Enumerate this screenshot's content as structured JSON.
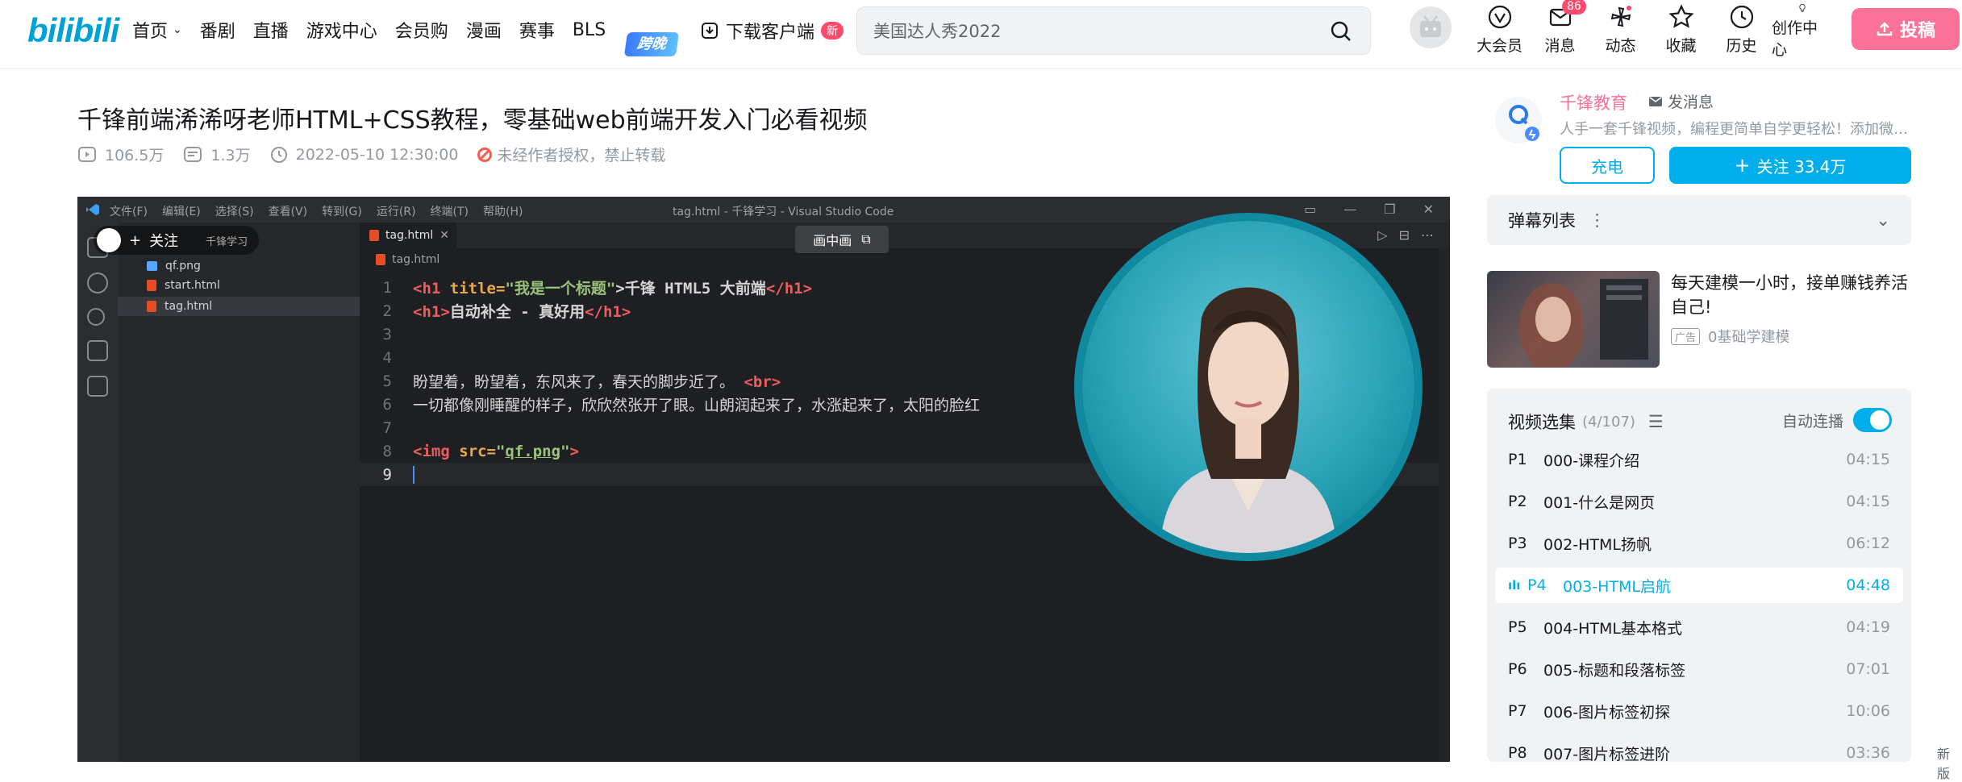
{
  "header": {
    "logo": "bilibili",
    "nav": [
      "首页",
      "番剧",
      "直播",
      "游戏中心",
      "会员购",
      "漫画",
      "赛事",
      "BLS"
    ],
    "bls_badge": "跨晚",
    "download": "下载客户端",
    "download_badge": "新",
    "search_value": "美国达人秀2022",
    "entries": [
      "大会员",
      "消息",
      "动态",
      "收藏",
      "历史",
      "创作中心"
    ],
    "message_count": "86",
    "upload": "投稿"
  },
  "video": {
    "title": "千锋前端浠浠呀老师HTML+CSS教程，零基础web前端开发入门必看视频",
    "views": "106.5万",
    "danmaku": "1.3万",
    "date": "2022-05-10 12:30:00",
    "notice": "未经作者授权，禁止转载"
  },
  "player": {
    "vs_menu": [
      "文件(F)",
      "编辑(E)",
      "选择(S)",
      "查看(V)",
      "转到(G)",
      "运行(R)",
      "终端(T)",
      "帮助(H)"
    ],
    "vs_title": "tag.html - 千锋学习 - Visual Studio Code",
    "follow_chip": "关注",
    "explorer_ghost": "千锋学习",
    "files": [
      "qf.png",
      "start.html",
      "tag.html"
    ],
    "tab": "tag.html",
    "breadcrumb": "tag.html",
    "pip_chip": "画中画",
    "lines": [
      "1",
      "2",
      "3",
      "4",
      "5",
      "6",
      "7",
      "8",
      "9"
    ],
    "code": {
      "l1_a": "<h1 ",
      "l1_attr": "title=",
      "l1_str": "\"我是一个标题\"",
      "l1_b": ">千锋 HTML5 大前端",
      "l1_c": "</h1>",
      "l2_a": "<h1>",
      "l2_b": "自动补全 - 真好用",
      "l2_c": "</h1>",
      "l5": "盼望着，盼望着，东风来了，春天的脚步近了。 ",
      "l5_br": "<br>",
      "l6": "一切都像刚睡醒的样子，欣欣然张开了眼。山朗润起来了，水涨起来了，太阳的脸红",
      "l8_a": "<img ",
      "l8_attr": "src=",
      "l8_q1": "\"",
      "l8_val": "qf.png",
      "l8_q2": "\"",
      "l8_b": ">"
    }
  },
  "uploader": {
    "name": "千锋教育",
    "message": "发消息",
    "desc": "人手一套千锋视频，编程更简单自学更轻松！添加微信：qianfengjiaoyu",
    "charge": "充电",
    "follow": "关注 33.4万"
  },
  "danmaku_list": "弹幕列表",
  "ad": {
    "title": "每天建模一小时，接单赚钱养活自己!",
    "tag": "广告",
    "source": "0基础学建模"
  },
  "playlist": {
    "title": "视频选集",
    "count": "(4/107)",
    "autoplay": "自动连播",
    "items": [
      {
        "num": "P1",
        "title": "000-课程介绍",
        "dur": "04:15"
      },
      {
        "num": "P2",
        "title": "001-什么是网页",
        "dur": "04:15"
      },
      {
        "num": "P3",
        "title": "002-HTML扬帆",
        "dur": "06:12"
      },
      {
        "num": "P4",
        "title": "003-HTML启航",
        "dur": "04:48"
      },
      {
        "num": "P5",
        "title": "004-HTML基本格式",
        "dur": "04:19"
      },
      {
        "num": "P6",
        "title": "005-标题和段落标签",
        "dur": "07:01"
      },
      {
        "num": "P7",
        "title": "006-图片标签初探",
        "dur": "10:06"
      },
      {
        "num": "P8",
        "title": "007-图片标签进阶",
        "dur": "03:36"
      }
    ]
  },
  "side_new": "新版"
}
